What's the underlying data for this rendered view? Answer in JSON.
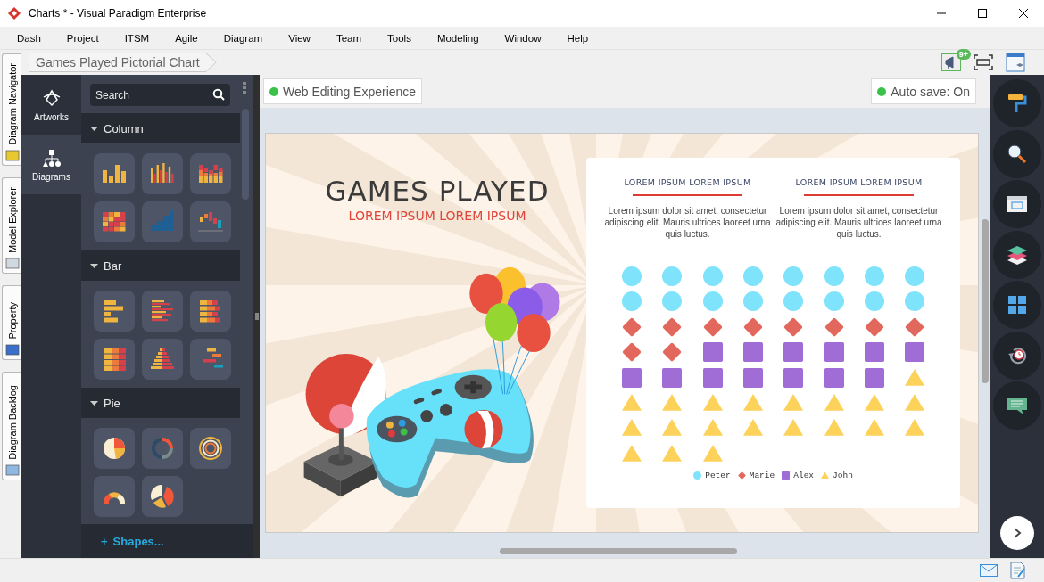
{
  "window": {
    "title": "Charts * - Visual Paradigm Enterprise"
  },
  "menu": [
    "Dash",
    "Project",
    "ITSM",
    "Agile",
    "Diagram",
    "View",
    "Team",
    "Tools",
    "Modeling",
    "Window",
    "Help"
  ],
  "side_tabs": [
    "Diagram Navigator",
    "Model Explorer",
    "Property",
    "Diagram Backlog"
  ],
  "breadcrumb": "Games Played Pictorial Chart",
  "notification_badge": "9+",
  "nav": [
    {
      "label": "Artworks",
      "selected": false
    },
    {
      "label": "Diagrams",
      "selected": true
    }
  ],
  "search": {
    "placeholder": "Search"
  },
  "sections": [
    {
      "title": "Column",
      "expanded": true,
      "tiles": [
        {
          "kind": "column"
        },
        {
          "kind": "grouped-column"
        },
        {
          "kind": "stacked-column"
        },
        {
          "kind": "heatmap-column"
        },
        {
          "kind": "step-column"
        },
        {
          "kind": "waterfall-column"
        }
      ]
    },
    {
      "title": "Bar",
      "expanded": true,
      "tiles": [
        {
          "kind": "bar"
        },
        {
          "kind": "grouped-bar"
        },
        {
          "kind": "stacked-bar"
        },
        {
          "kind": "heatmap-bar"
        },
        {
          "kind": "pyramid-bar"
        },
        {
          "kind": "gantt-bar"
        }
      ]
    },
    {
      "title": "Pie",
      "expanded": true,
      "tiles": [
        {
          "kind": "pie"
        },
        {
          "kind": "donut"
        },
        {
          "kind": "rings"
        },
        {
          "kind": "gauge"
        },
        {
          "kind": "exploded-pie"
        }
      ]
    }
  ],
  "shapes_link": {
    "icon": "+",
    "label": "Shapes..."
  },
  "status": [
    {
      "label": "Web Editing Experience"
    },
    {
      "label": "Auto save: On"
    }
  ],
  "slide": {
    "title": "GAMES PLAYED",
    "subtitle": "LOREM IPSUM LOREM IPSUM",
    "columns": [
      {
        "heading": "LOREM IPSUM LOREM IPSUM",
        "body": "Lorem ipsum dolor sit amet, consectetur adipiscing elit. Mauris ultrices laoreet urna quis luctus."
      },
      {
        "heading": "LOREM IPSUM LOREM IPSUM",
        "body": "Lorem ipsum dolor sit amet, consectetur adipiscing elit. Mauris ultrices laoreet urna quis luctus."
      }
    ],
    "legend": [
      {
        "name": "Peter",
        "kind": "circle",
        "color": "#7fe3fb"
      },
      {
        "name": "Marie",
        "kind": "diamond",
        "color": "#e2685e"
      },
      {
        "name": "Alex",
        "kind": "square",
        "color": "#a06cd5"
      },
      {
        "name": "John",
        "kind": "triangle",
        "color": "#fdd25a"
      }
    ],
    "icons": [
      {
        "kind": "circle"
      },
      {
        "kind": "circle"
      },
      {
        "kind": "circle"
      },
      {
        "kind": "circle"
      },
      {
        "kind": "circle"
      },
      {
        "kind": "circle"
      },
      {
        "kind": "circle"
      },
      {
        "kind": "circle"
      },
      {
        "kind": "circle"
      },
      {
        "kind": "circle"
      },
      {
        "kind": "circle"
      },
      {
        "kind": "circle"
      },
      {
        "kind": "circle"
      },
      {
        "kind": "circle"
      },
      {
        "kind": "circle"
      },
      {
        "kind": "circle"
      },
      {
        "kind": "diamond"
      },
      {
        "kind": "diamond"
      },
      {
        "kind": "diamond"
      },
      {
        "kind": "diamond"
      },
      {
        "kind": "diamond"
      },
      {
        "kind": "diamond"
      },
      {
        "kind": "diamond"
      },
      {
        "kind": "diamond"
      },
      {
        "kind": "diamond"
      },
      {
        "kind": "diamond"
      },
      {
        "kind": "square"
      },
      {
        "kind": "square"
      },
      {
        "kind": "square"
      },
      {
        "kind": "square"
      },
      {
        "kind": "square"
      },
      {
        "kind": "square"
      },
      {
        "kind": "square"
      },
      {
        "kind": "square"
      },
      {
        "kind": "square"
      },
      {
        "kind": "square"
      },
      {
        "kind": "square"
      },
      {
        "kind": "square"
      },
      {
        "kind": "square"
      },
      {
        "kind": "triangle"
      },
      {
        "kind": "triangle"
      },
      {
        "kind": "triangle"
      },
      {
        "kind": "triangle"
      },
      {
        "kind": "triangle"
      },
      {
        "kind": "triangle"
      },
      {
        "kind": "triangle"
      },
      {
        "kind": "triangle"
      },
      {
        "kind": "triangle"
      },
      {
        "kind": "triangle"
      },
      {
        "kind": "triangle"
      },
      {
        "kind": "triangle"
      },
      {
        "kind": "triangle"
      },
      {
        "kind": "triangle"
      },
      {
        "kind": "triangle"
      },
      {
        "kind": "triangle"
      },
      {
        "kind": "triangle"
      },
      {
        "kind": "triangle"
      },
      {
        "kind": "triangle"
      },
      {
        "kind": "triangle"
      }
    ]
  }
}
